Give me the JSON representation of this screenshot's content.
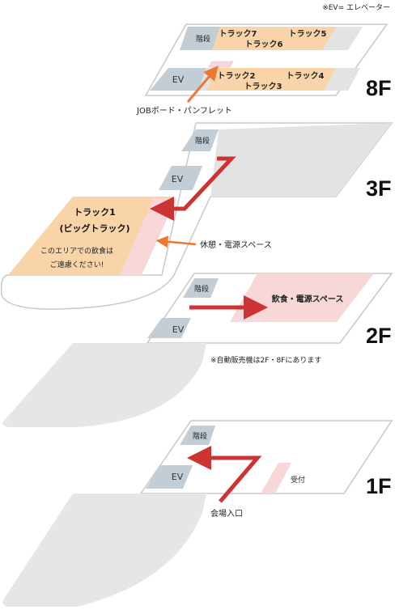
{
  "note_ev": "※EV= エレベーター",
  "floors": {
    "f8": {
      "label": "8F",
      "stairs": "階段",
      "ev": "EV",
      "tracks_top": [
        "トラック7",
        "トラック6",
        "トラック5"
      ],
      "tracks_bottom": [
        "トラック2",
        "トラック3",
        "トラック4"
      ],
      "callout": "JOBボード・パンフレット"
    },
    "f3": {
      "label": "3F",
      "stairs": "階段",
      "ev": "EV",
      "track_name": "トラック1",
      "track_sub": "(ビッグトラック)",
      "area_note_1": "このエリアでの飲食は",
      "area_note_2": "ご遠慮ください!",
      "callout": "休憩・電源スペース"
    },
    "f2": {
      "label": "2F",
      "stairs": "階段",
      "ev": "EV",
      "area": "飲食・電源スペース",
      "note": "※自動販売機は2F・8Fにあります"
    },
    "f1": {
      "label": "1F",
      "stairs": "階段",
      "ev": "EV",
      "reception": "受付",
      "entrance": "会場入口"
    }
  },
  "colors": {
    "floor_fill": "#e6e6e6",
    "stairs_fill": "#c3cdd5",
    "track_fill": "#f9d4a8",
    "rest_fill": "#f8d7d9",
    "route_arrow": "#cc3333",
    "callout_arrow": "#ee7733"
  }
}
